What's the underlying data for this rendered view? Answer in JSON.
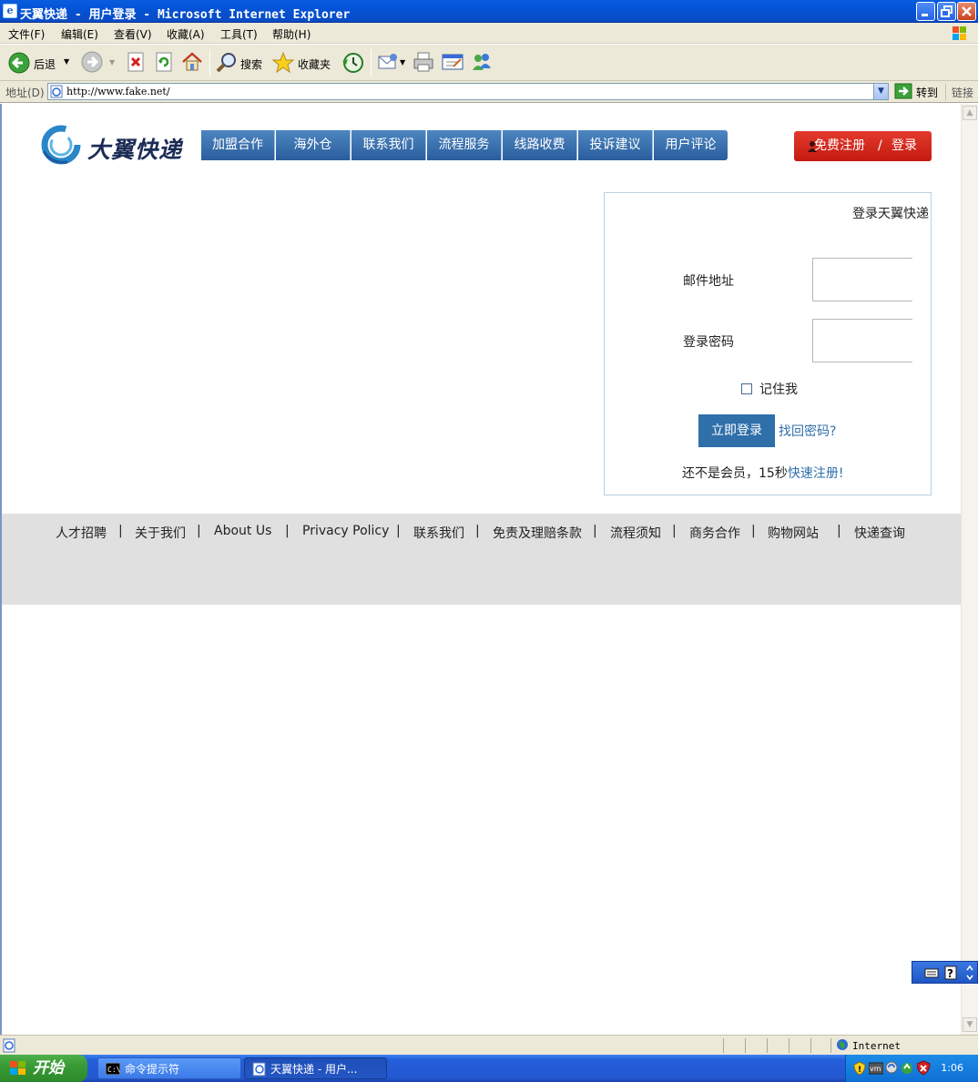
{
  "window": {
    "title": "天翼快递 - 用户登录 - Microsoft Internet Explorer",
    "icon_glyph": "e"
  },
  "menu": [
    "文件(F)",
    "编辑(E)",
    "查看(V)",
    "收藏(A)",
    "工具(T)",
    "帮助(H)"
  ],
  "toolbar": {
    "back": "后退",
    "search": "搜索",
    "favorites": "收藏夹"
  },
  "address": {
    "label": "地址(D)",
    "url": "http://www.fake.net/",
    "go": "转到",
    "links": "链接"
  },
  "site": {
    "logo_text": "大翼快递",
    "nav": [
      "加盟合作",
      "海外仓",
      "联系我们",
      "流程服务",
      "线路收费",
      "投诉建议",
      "用户评论"
    ],
    "register": "免费注册",
    "separator": "/",
    "login": "登录"
  },
  "login_form": {
    "title": "登录天翼快递",
    "email_label": "邮件地址",
    "email_value": "",
    "password_label": "登录密码",
    "password_value": "",
    "remember_label": "记住我",
    "remember_checked": false,
    "submit": "立即登录",
    "forgot": "找回密码?",
    "notmember_prefix": "还不是会员，15秒",
    "notmember_link": "快速注册!"
  },
  "footer": {
    "links": [
      "人才招聘",
      "关于我们",
      "About Us",
      "Privacy Policy",
      "联系我们",
      "免责及理赔条款",
      "流程须知",
      "商务合作",
      "购物网站",
      "快递查询"
    ],
    "separator": "|"
  },
  "status": {
    "zone": "Internet"
  },
  "taskbar": {
    "start": "开始",
    "tasks": [
      "命令提示符",
      "天翼快递 - 用户..."
    ],
    "clock": "1:06"
  },
  "colors": {
    "nav_blue": "#2a5d9d",
    "register_red": "#c41a10",
    "link_blue": "#2f6faa",
    "footer_gray": "#e0e0e0"
  }
}
